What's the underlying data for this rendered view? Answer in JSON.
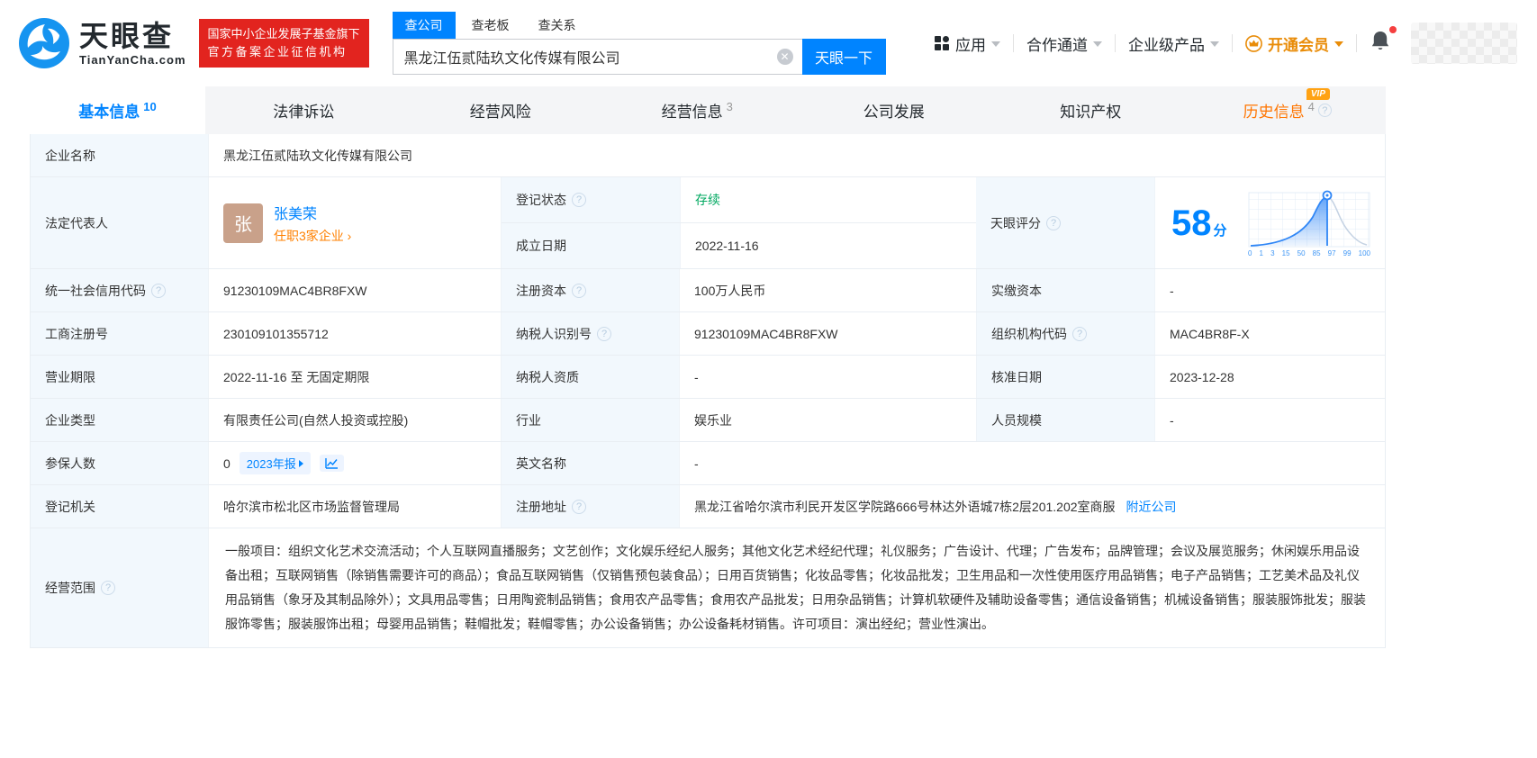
{
  "colors": {
    "accent": "#0084ff",
    "orange": "#ff8000",
    "green": "#00a860",
    "badge_red": "#e2241f",
    "history_orange": "#ff7500"
  },
  "header": {
    "logo": {
      "brand": "天眼查",
      "domain": "TianYanCha.com"
    },
    "gov_badge": {
      "line1": "国家中小企业发展子基金旗下",
      "line2": "官方备案企业征信机构"
    },
    "search": {
      "tabs": [
        {
          "label": "查公司",
          "active": true
        },
        {
          "label": "查老板",
          "active": false
        },
        {
          "label": "查关系",
          "active": false
        }
      ],
      "value": "黑龙江伍贰陆玖文化传媒有限公司",
      "button": "天眼一下"
    },
    "nav": [
      {
        "label": "应用"
      },
      {
        "label": "合作通道"
      },
      {
        "label": "企业级产品"
      },
      {
        "label": "开通会员"
      }
    ]
  },
  "tabs": [
    {
      "label": "基本信息",
      "count": "10",
      "active": true
    },
    {
      "label": "法律诉讼",
      "count": ""
    },
    {
      "label": "经营风险",
      "count": ""
    },
    {
      "label": "经营信息",
      "count": "3"
    },
    {
      "label": "公司发展",
      "count": ""
    },
    {
      "label": "知识产权",
      "count": ""
    },
    {
      "label": "历史信息",
      "count": "4",
      "vip": "VIP"
    }
  ],
  "info": {
    "company_name": {
      "label": "企业名称",
      "value": "黑龙江伍贰陆玖文化传媒有限公司"
    },
    "legal_rep": {
      "label": "法定代表人",
      "avatar": "张",
      "name": "张美荣",
      "companies_link": "任职3家企业 ›"
    },
    "reg_status": {
      "label": "登记状态",
      "value": "存续"
    },
    "establish_date": {
      "label": "成立日期",
      "value": "2022-11-16"
    },
    "score": {
      "label": "天眼评分",
      "value": "58",
      "unit": "分",
      "ticks": [
        "0",
        "1",
        "3",
        "15",
        "50",
        "85",
        "97",
        "99",
        "100"
      ]
    },
    "credit_code": {
      "label": "统一社会信用代码",
      "value": "91230109MAC4BR8FXW"
    },
    "reg_capital": {
      "label": "注册资本",
      "value": "100万人民币"
    },
    "paid_capital": {
      "label": "实缴资本",
      "value": "-"
    },
    "reg_number": {
      "label": "工商注册号",
      "value": "230109101355712"
    },
    "taxpayer_id": {
      "label": "纳税人识别号",
      "value": "91230109MAC4BR8FXW"
    },
    "org_code": {
      "label": "组织机构代码",
      "value": "MAC4BR8F-X"
    },
    "business_term": {
      "label": "营业期限",
      "value": "2022-11-16 至 无固定期限"
    },
    "taxpayer_quality": {
      "label": "纳税人资质",
      "value": "-"
    },
    "approval_date": {
      "label": "核准日期",
      "value": "2023-12-28"
    },
    "company_type": {
      "label": "企业类型",
      "value": "有限责任公司(自然人投资或控股)"
    },
    "industry": {
      "label": "行业",
      "value": "娱乐业"
    },
    "staff_size": {
      "label": "人员规模",
      "value": "-"
    },
    "insured_count": {
      "label": "参保人数",
      "value": "0",
      "report_chip": "2023年报"
    },
    "english_name": {
      "label": "英文名称",
      "value": "-"
    },
    "reg_authority": {
      "label": "登记机关",
      "value": "哈尔滨市松北区市场监督管理局"
    },
    "reg_address": {
      "label": "注册地址",
      "value": "黑龙江省哈尔滨市利民开发区学院路666号林达外语城7栋2层201.202室商服",
      "nearby_link": "附近公司"
    },
    "business_scope": {
      "label": "经营范围",
      "value": "一般项目：组织文化艺术交流活动；个人互联网直播服务；文艺创作；文化娱乐经纪人服务；其他文化艺术经纪代理；礼仪服务；广告设计、代理；广告发布；品牌管理；会议及展览服务；休闲娱乐用品设备出租；互联网销售（除销售需要许可的商品）；食品互联网销售（仅销售预包装食品）；日用百货销售；化妆品零售；化妆品批发；卫生用品和一次性使用医疗用品销售；电子产品销售；工艺美术品及礼仪用品销售（象牙及其制品除外）；文具用品零售；日用陶瓷制品销售；食用农产品零售；食用农产品批发；日用杂品销售；计算机软硬件及辅助设备零售；通信设备销售；机械设备销售；服装服饰批发；服装服饰零售；服装服饰出租；母婴用品销售；鞋帽批发；鞋帽零售；办公设备销售；办公设备耗材销售。许可项目：演出经纪；营业性演出。"
    }
  }
}
